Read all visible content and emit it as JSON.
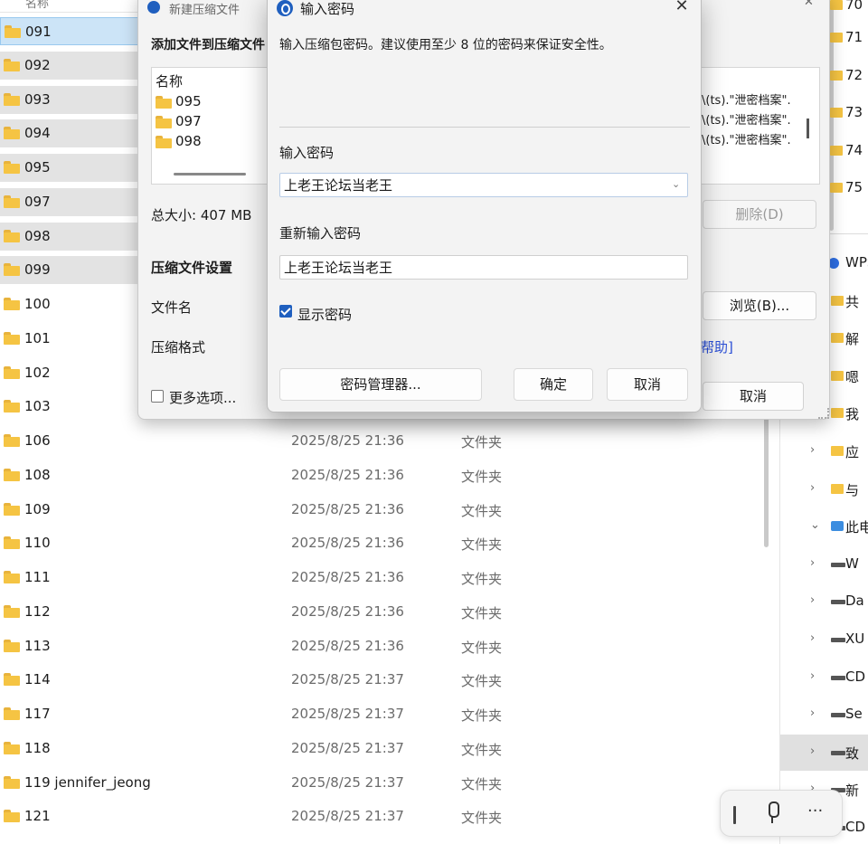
{
  "explorer": {
    "header_fragment": "名称",
    "files": [
      {
        "name": "091",
        "date": "",
        "type": "",
        "state": "selected-blue"
      },
      {
        "name": "092",
        "date": "",
        "type": "",
        "state": "selected"
      },
      {
        "name": "093",
        "date": "",
        "type": "",
        "state": "selected"
      },
      {
        "name": "094",
        "date": "",
        "type": "",
        "state": "selected"
      },
      {
        "name": "095",
        "date": "",
        "type": "",
        "state": "selected"
      },
      {
        "name": "097",
        "date": "",
        "type": "",
        "state": "selected"
      },
      {
        "name": "098",
        "date": "",
        "type": "",
        "state": "selected"
      },
      {
        "name": "099",
        "date": "",
        "type": "",
        "state": "selected"
      },
      {
        "name": "100",
        "date": "",
        "type": "",
        "state": ""
      },
      {
        "name": "101",
        "date": "",
        "type": "",
        "state": ""
      },
      {
        "name": "102",
        "date": "",
        "type": "",
        "state": ""
      },
      {
        "name": "103",
        "date": "",
        "type": "",
        "state": ""
      },
      {
        "name": "106",
        "date": "2025/8/25 21:36",
        "type": "文件夹",
        "state": ""
      },
      {
        "name": "108",
        "date": "2025/8/25 21:36",
        "type": "文件夹",
        "state": ""
      },
      {
        "name": "109",
        "date": "2025/8/25 21:36",
        "type": "文件夹",
        "state": ""
      },
      {
        "name": "110",
        "date": "2025/8/25 21:36",
        "type": "文件夹",
        "state": ""
      },
      {
        "name": "111",
        "date": "2025/8/25 21:36",
        "type": "文件夹",
        "state": ""
      },
      {
        "name": "112",
        "date": "2025/8/25 21:36",
        "type": "文件夹",
        "state": ""
      },
      {
        "name": "113",
        "date": "2025/8/25 21:36",
        "type": "文件夹",
        "state": ""
      },
      {
        "name": "114",
        "date": "2025/8/25 21:37",
        "type": "文件夹",
        "state": ""
      },
      {
        "name": "117",
        "date": "2025/8/25 21:37",
        "type": "文件夹",
        "state": ""
      },
      {
        "name": "118",
        "date": "2025/8/25 21:37",
        "type": "文件夹",
        "state": ""
      },
      {
        "name": "119 jennifer_jeong",
        "date": "2025/8/25 21:37",
        "type": "文件夹",
        "state": ""
      },
      {
        "name": "121",
        "date": "2025/8/25 21:37",
        "type": "文件夹",
        "state": ""
      }
    ]
  },
  "nav_pane": {
    "numbered_folders": [
      "70",
      "71",
      "72",
      "73",
      "74",
      "75"
    ],
    "items": [
      {
        "label": "WPS",
        "icon": "wps",
        "chevron": "",
        "selected": false
      },
      {
        "label": "共",
        "icon": "folder",
        "chevron": "",
        "selected": false
      },
      {
        "label": "解",
        "icon": "folder",
        "chevron": "",
        "selected": false
      },
      {
        "label": "嗯",
        "icon": "folder",
        "chevron": "",
        "selected": false
      },
      {
        "label": "我",
        "icon": "folder",
        "chevron": "",
        "selected": false
      },
      {
        "label": "应",
        "icon": "folder",
        "chevron": "›",
        "selected": false
      },
      {
        "label": "与",
        "icon": "folder",
        "chevron": "›",
        "selected": false
      },
      {
        "label": "此电",
        "icon": "pc",
        "chevron": "⌄",
        "selected": false
      },
      {
        "label": "W",
        "icon": "drive",
        "chevron": "›",
        "selected": false
      },
      {
        "label": "Da",
        "icon": "drive",
        "chevron": "›",
        "selected": false
      },
      {
        "label": "XU",
        "icon": "drive",
        "chevron": "›",
        "selected": false
      },
      {
        "label": "CD",
        "icon": "drive",
        "chevron": "›",
        "selected": false
      },
      {
        "label": "Se",
        "icon": "drive",
        "chevron": "›",
        "selected": false
      },
      {
        "label": "致",
        "icon": "drive",
        "chevron": "›",
        "selected": true
      },
      {
        "label": "新",
        "icon": "drive",
        "chevron": "›",
        "selected": false
      },
      {
        "label": "CD",
        "icon": "drive",
        "chevron": "",
        "selected": false
      }
    ]
  },
  "compress_dialog": {
    "title": "新建压缩文件",
    "add_files_label": "添加文件到压缩文件",
    "list_header": "名称",
    "list_items": [
      "095",
      "097",
      "098"
    ],
    "path_cells": [
      "\\(ts).\"泄密档案\".",
      "\\(ts).\"泄密档案\".",
      "\\(ts).\"泄密档案\"."
    ],
    "total_size": "总大小: 407 MB",
    "delete_button": "删除(D)",
    "settings_label": "压缩文件设置",
    "filename_label": "文件名",
    "browse_button": "浏览(B)...",
    "format_label": "压缩格式",
    "help_link": "帮助]",
    "more_options": "更多选项...",
    "cancel_button": "取消"
  },
  "password_dialog": {
    "title": "输入密码",
    "description": "输入压缩包密码。建议使用至少 8 位的密码来保证安全性。",
    "password_label": "输入密码",
    "password_value": "上老王论坛当老王",
    "confirm_label": "重新输入密码",
    "confirm_value": "上老王论坛当老王",
    "show_password_label": "显示密码",
    "show_password_checked": true,
    "manager_button": "密码管理器...",
    "ok_button": "确定",
    "cancel_button": "取消",
    "accent_color": "#1f5fbf"
  },
  "voice_toolbar": {
    "more_label": "···"
  }
}
